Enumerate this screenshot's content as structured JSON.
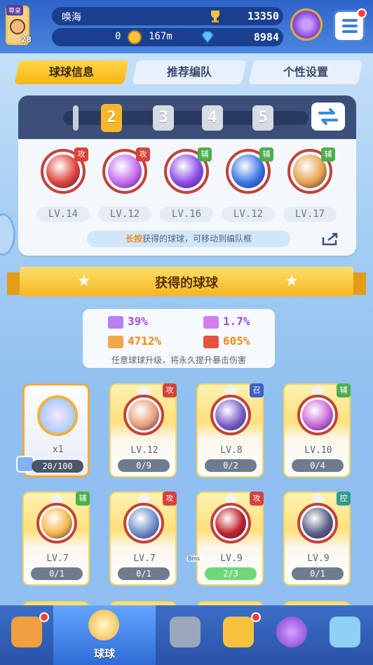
{
  "player": {
    "rank_label": "尊皇",
    "level": "28",
    "name": "唤海",
    "trophies": "13350",
    "coins": "0",
    "distance": "167m",
    "gems": "8984"
  },
  "tabs": [
    {
      "label": "球球信息",
      "active": true
    },
    {
      "label": "推荐编队",
      "active": false
    },
    {
      "label": "个性设置",
      "active": false
    }
  ],
  "team": {
    "slots": [
      "2",
      "3",
      "4",
      "5"
    ],
    "active_slot": "2",
    "balls": [
      {
        "badge": "攻",
        "type": "atk",
        "level": "LV.14",
        "color": "#e0443a"
      },
      {
        "badge": "攻",
        "type": "atk",
        "level": "LV.12",
        "color": "#c66df2"
      },
      {
        "badge": "辅",
        "type": "sup",
        "level": "LV.16",
        "color": "#8b4ee8"
      },
      {
        "badge": "辅",
        "type": "sup",
        "level": "LV.12",
        "color": "#3a77e8"
      },
      {
        "badge": "辅",
        "type": "sup",
        "level": "LV.17",
        "color": "#e6a24a"
      }
    ],
    "hint_highlight": "长按",
    "hint_text": "获得的球球，可移动到编队框"
  },
  "section_title": "获得的球球",
  "stats": [
    {
      "value": "39%",
      "color": "#a34de0"
    },
    {
      "value": "1.7%",
      "color": "#a34de0"
    },
    {
      "value": "4712%",
      "color": "#f08a12"
    },
    {
      "value": "605%",
      "color": "#f08a12"
    }
  ],
  "stats_note": "任意球球升级，将永久提升暴击伤害",
  "cards": [
    {
      "special": true,
      "count": "x1",
      "progress": "20/100"
    },
    {
      "badge": "攻",
      "type": "atk",
      "level": "LV.12",
      "progress": "0/9",
      "color": "#e9a07a"
    },
    {
      "badge": "召",
      "type": "sum",
      "level": "LV.8",
      "progress": "0/2",
      "color": "#7b5fc9"
    },
    {
      "badge": "辅",
      "type": "sup",
      "level": "LV.10",
      "progress": "0/4",
      "color": "#c86ad8"
    },
    {
      "badge": "辅",
      "type": "sup",
      "level": "LV.7",
      "progress": "0/1",
      "color": "#f5b84a"
    },
    {
      "badge": "攻",
      "type": "atk",
      "level": "LV.7",
      "progress": "0/1",
      "color": "#6f8fc9"
    },
    {
      "badge": "攻",
      "type": "atk",
      "level": "LV.9",
      "progress": "2/3",
      "color": "#c0232b",
      "full": true
    },
    {
      "badge": "控",
      "type": "ctl",
      "level": "LV.9",
      "progress": "0/1",
      "color": "#5a5f85"
    }
  ],
  "tiny_label": "8ms",
  "nav": [
    {
      "name": "shop",
      "label": "",
      "dot": true
    },
    {
      "name": "balls",
      "label": "球球",
      "active": true
    },
    {
      "name": "battle",
      "label": ""
    },
    {
      "name": "whistle",
      "label": "",
      "dot": true
    },
    {
      "name": "planet",
      "label": ""
    },
    {
      "name": "social",
      "label": ""
    }
  ]
}
